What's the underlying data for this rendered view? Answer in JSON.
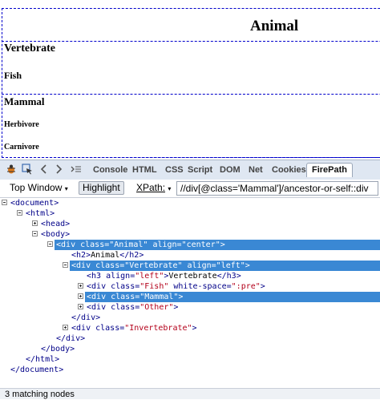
{
  "preview": {
    "animal": "Animal",
    "vertebrate": "Vertebrate",
    "fish": "Fish",
    "mammal": "Mammal",
    "herbivore": "Herbivore",
    "carnivore": "Carnivore"
  },
  "tabs": [
    "Console",
    "HTML",
    "CSS",
    "Script",
    "DOM",
    "Net",
    "Cookies",
    "FirePath"
  ],
  "toolbar": {
    "top_window": "Top Window",
    "highlight": "Highlight",
    "xpath_label": "XPath:",
    "xpath_value": "//div[@class='Mammal']/ancestor-or-self::div"
  },
  "tree": [
    {
      "open": "<",
      "tag": "document",
      "close": ">"
    },
    {
      "open": "<",
      "tag": "html",
      "close": ">"
    },
    {
      "open": "<",
      "tag": "head",
      "close": ">"
    },
    {
      "open": "<",
      "tag": "body",
      "close": ">"
    },
    {
      "open": "<",
      "tag": "div",
      "a1": " class=",
      "v1": "\"Animal\"",
      "a2": " align=",
      "v2": "\"center\"",
      "close": ">"
    },
    {
      "open": "<",
      "tag": "h2",
      "close": ">",
      "text": "Animal",
      "end": "</h2>"
    },
    {
      "open": "<",
      "tag": "div",
      "a1": " class=",
      "v1": "\"Vertebrate\"",
      "a2": " align=",
      "v2": "\"left\"",
      "close": ">"
    },
    {
      "open": "<",
      "tag": "h3",
      "a1": " align=",
      "v1": "\"left\"",
      "close": ">",
      "text": "Vertebrate",
      "end": "</h3>"
    },
    {
      "open": "<",
      "tag": "div",
      "a1": " class=",
      "v1": "\"Fish\"",
      "a2": " white-space=",
      "v2": "\":pre\"",
      "close": ">"
    },
    {
      "open": "<",
      "tag": "div",
      "a1": " class=",
      "v1": "\"Mammal\"",
      "close": ">"
    },
    {
      "open": "<",
      "tag": "div",
      "a1": " class=",
      "v1": "\"Other\"",
      "close": ">"
    },
    {
      "end": "</div>"
    },
    {
      "open": "<",
      "tag": "div",
      "a1": " class=",
      "v1": "\"Invertebrate\"",
      "close": ">"
    },
    {
      "end": "</div>"
    },
    {
      "end": "</body>"
    },
    {
      "end": "</html>"
    },
    {
      "end": "</document>"
    }
  ],
  "status": "3 matching nodes"
}
